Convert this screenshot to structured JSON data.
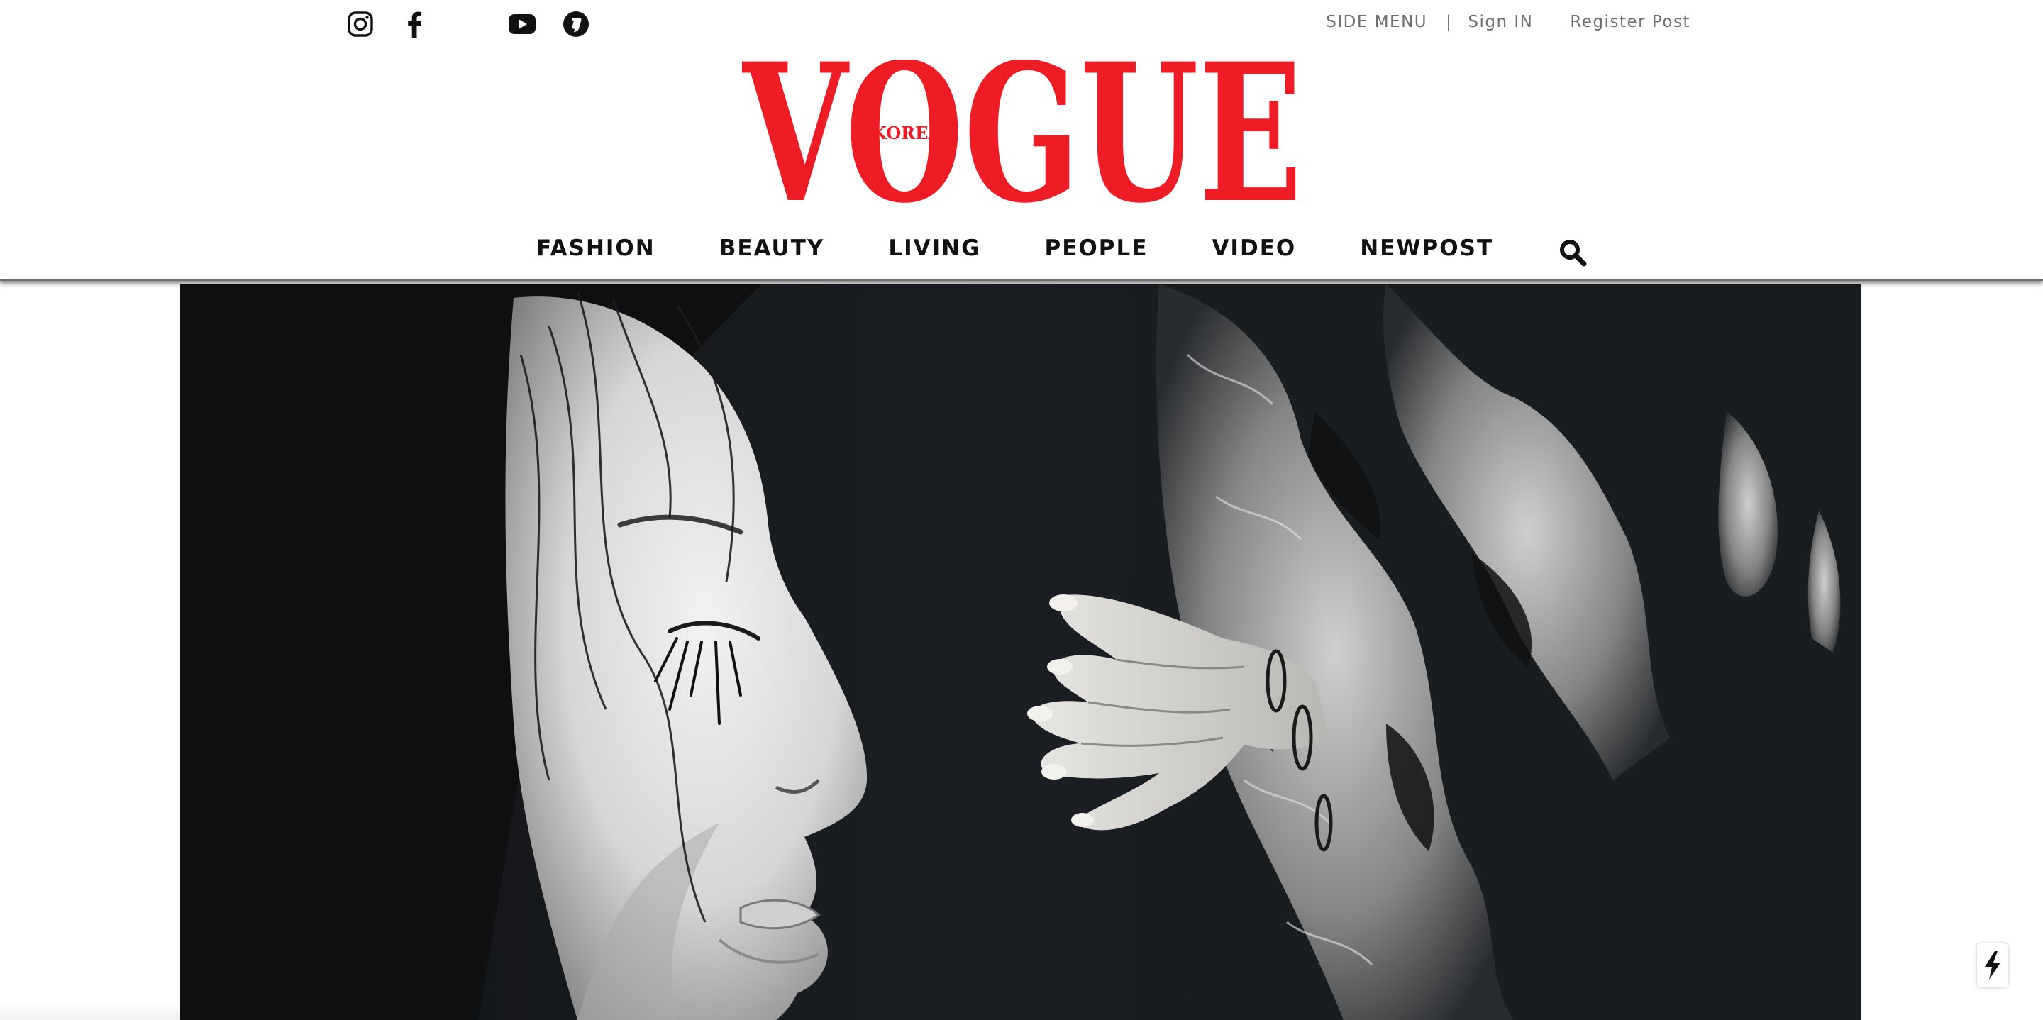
{
  "brand": {
    "name": "VOGUE",
    "edition": "KOREA",
    "color": "#ee1c25"
  },
  "social": [
    {
      "name": "instagram",
      "icon": "instagram-icon"
    },
    {
      "name": "facebook",
      "icon": "facebook-icon"
    },
    {
      "name": "youtube",
      "icon": "youtube-icon"
    },
    {
      "name": "kakao",
      "icon": "kakao-story-icon"
    }
  ],
  "top_links": {
    "side_menu": "SIDE MENU",
    "separator": "|",
    "sign_in": "Sign IN",
    "register_post": "Register Post"
  },
  "nav": {
    "items": [
      {
        "label": "FASHION"
      },
      {
        "label": "BEAUTY"
      },
      {
        "label": "LIVING"
      },
      {
        "label": "PEOPLE"
      },
      {
        "label": "VIDEO"
      },
      {
        "label": "NEWPOST"
      }
    ],
    "search_icon": "search-icon"
  },
  "hero": {
    "description_icon": "hero-photo",
    "palette": [
      "#15181b",
      "#c9c9c9",
      "#ededed"
    ]
  },
  "floating": {
    "icon": "lightning-icon"
  }
}
